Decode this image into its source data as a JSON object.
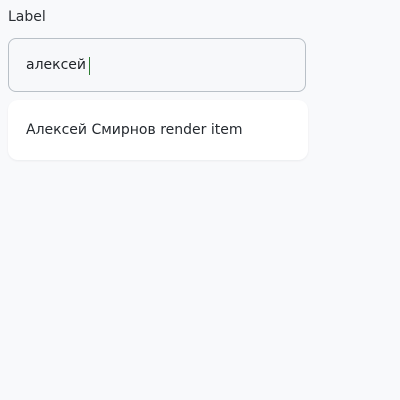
{
  "field": {
    "label": "Label",
    "value": "алексей",
    "placeholder": ""
  },
  "suggestions": {
    "items": [
      {
        "label": "Алексей Смирнов render item"
      }
    ]
  },
  "colors": {
    "background": "#f8f9fb",
    "input_border": "#b9c0c7",
    "caret": "#2e7d32",
    "surface": "#ffffff"
  }
}
